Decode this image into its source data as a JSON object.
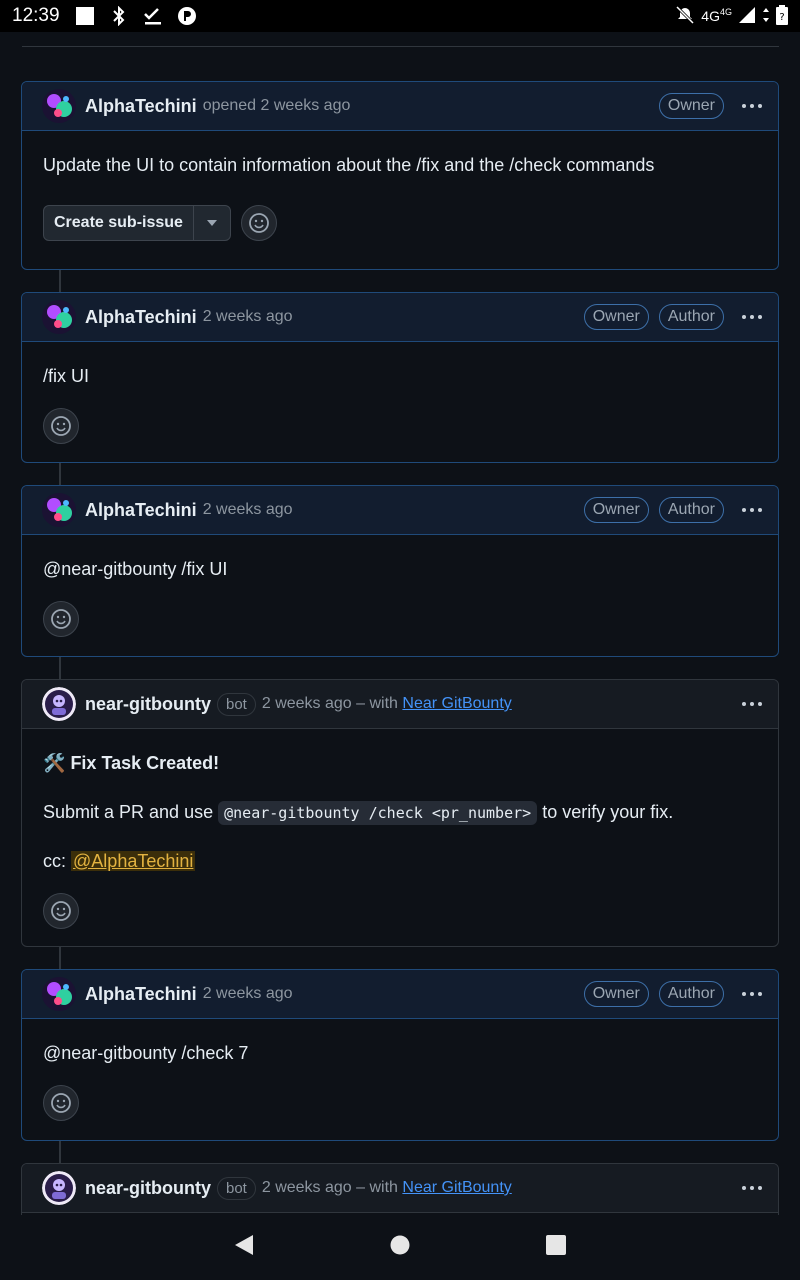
{
  "status_bar": {
    "time": "12:39",
    "network": "4G",
    "network_sup": "4G"
  },
  "comments": [
    {
      "author": "AlphaTechini",
      "meta": "opened 2 weeks ago",
      "labels": [
        "Owner"
      ],
      "body": "Update the UI to contain information about the /fix and the /check commands",
      "sub_issue_button": "Create sub-issue"
    },
    {
      "author": "AlphaTechini",
      "meta": "2 weeks ago",
      "labels": [
        "Owner",
        "Author"
      ],
      "body": "/fix UI"
    },
    {
      "author": "AlphaTechini",
      "meta": "2 weeks ago",
      "labels": [
        "Owner",
        "Author"
      ],
      "body": "@near-gitbounty /fix UI"
    },
    {
      "author": "near-gitbounty",
      "bot_badge": "bot",
      "meta_prefix": "2 weeks ago – with",
      "meta_link": "Near GitBounty",
      "heading_emoji": "🛠️",
      "heading": "Fix Task Created!",
      "line_prefix": "Submit a PR and use",
      "line_code": "@near-gitbounty /check <pr_number>",
      "line_suffix": "to verify your fix.",
      "cc_label": "cc:",
      "cc_mention": "@AlphaTechini"
    },
    {
      "author": "AlphaTechini",
      "meta": "2 weeks ago",
      "labels": [
        "Owner",
        "Author"
      ],
      "body": "@near-gitbounty /check 7"
    },
    {
      "author": "near-gitbounty",
      "bot_badge": "bot",
      "meta_prefix": "2 weeks ago – with",
      "meta_link": "Near GitBounty"
    }
  ],
  "icons": {
    "more": "kebab-horizontal-icon",
    "emoji": "smiley-icon",
    "caret": "triangle-down-icon"
  },
  "colors": {
    "background": "#0d1117",
    "owner_border": "#1f4a7a",
    "link": "#4493f8",
    "mention": "#e3b341"
  }
}
